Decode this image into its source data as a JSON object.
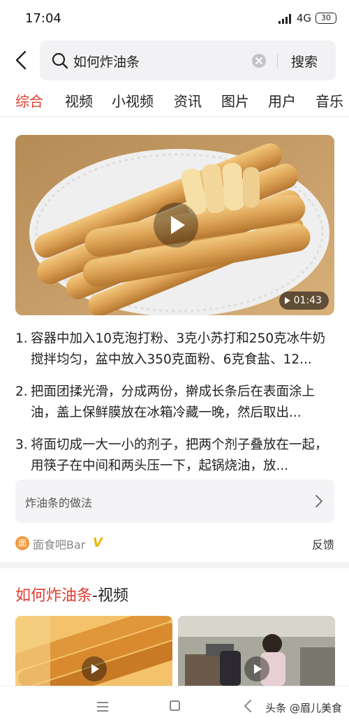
{
  "status_bar": {
    "time": "17:04",
    "network": "4G",
    "battery": "30"
  },
  "search": {
    "query": "如何炸油条",
    "submit_label": "搜索"
  },
  "tabs": [
    {
      "label": "综合",
      "active": true
    },
    {
      "label": "视频"
    },
    {
      "label": "小视频"
    },
    {
      "label": "资讯"
    },
    {
      "label": "图片"
    },
    {
      "label": "用户"
    },
    {
      "label": "音乐"
    }
  ],
  "video": {
    "duration": "01:43"
  },
  "steps": [
    {
      "num": "1.",
      "text": "容器中加入10克泡打粉、3克小苏打和250克冰牛奶搅拌均匀，盆中放入350克面粉、6克食盐、12..."
    },
    {
      "num": "2.",
      "text": "把面团揉光滑，分成两份，擀成长条后在表面涂上油，盖上保鲜膜放在冰箱冷藏一晚，然后取出..."
    },
    {
      "num": "3.",
      "text": "将面切成一大一小的剂子，把两个剂子叠放在一起，用筷子在中间和两头压一下，起锅烧油，放..."
    }
  ],
  "related": {
    "label": "炸油条的做法"
  },
  "source": {
    "logo_char": "面",
    "name": "面食吧Bar",
    "verified_mark": "V",
    "feedback_label": "反馈"
  },
  "video_section": {
    "title_highlight": "如何炸油条",
    "title_rest": "-视频"
  },
  "watermark": "头条 @眉儿美食",
  "colors": {
    "accent": "#e23b30",
    "verified": "#f0b400",
    "source_logo": "#f19a3b"
  }
}
